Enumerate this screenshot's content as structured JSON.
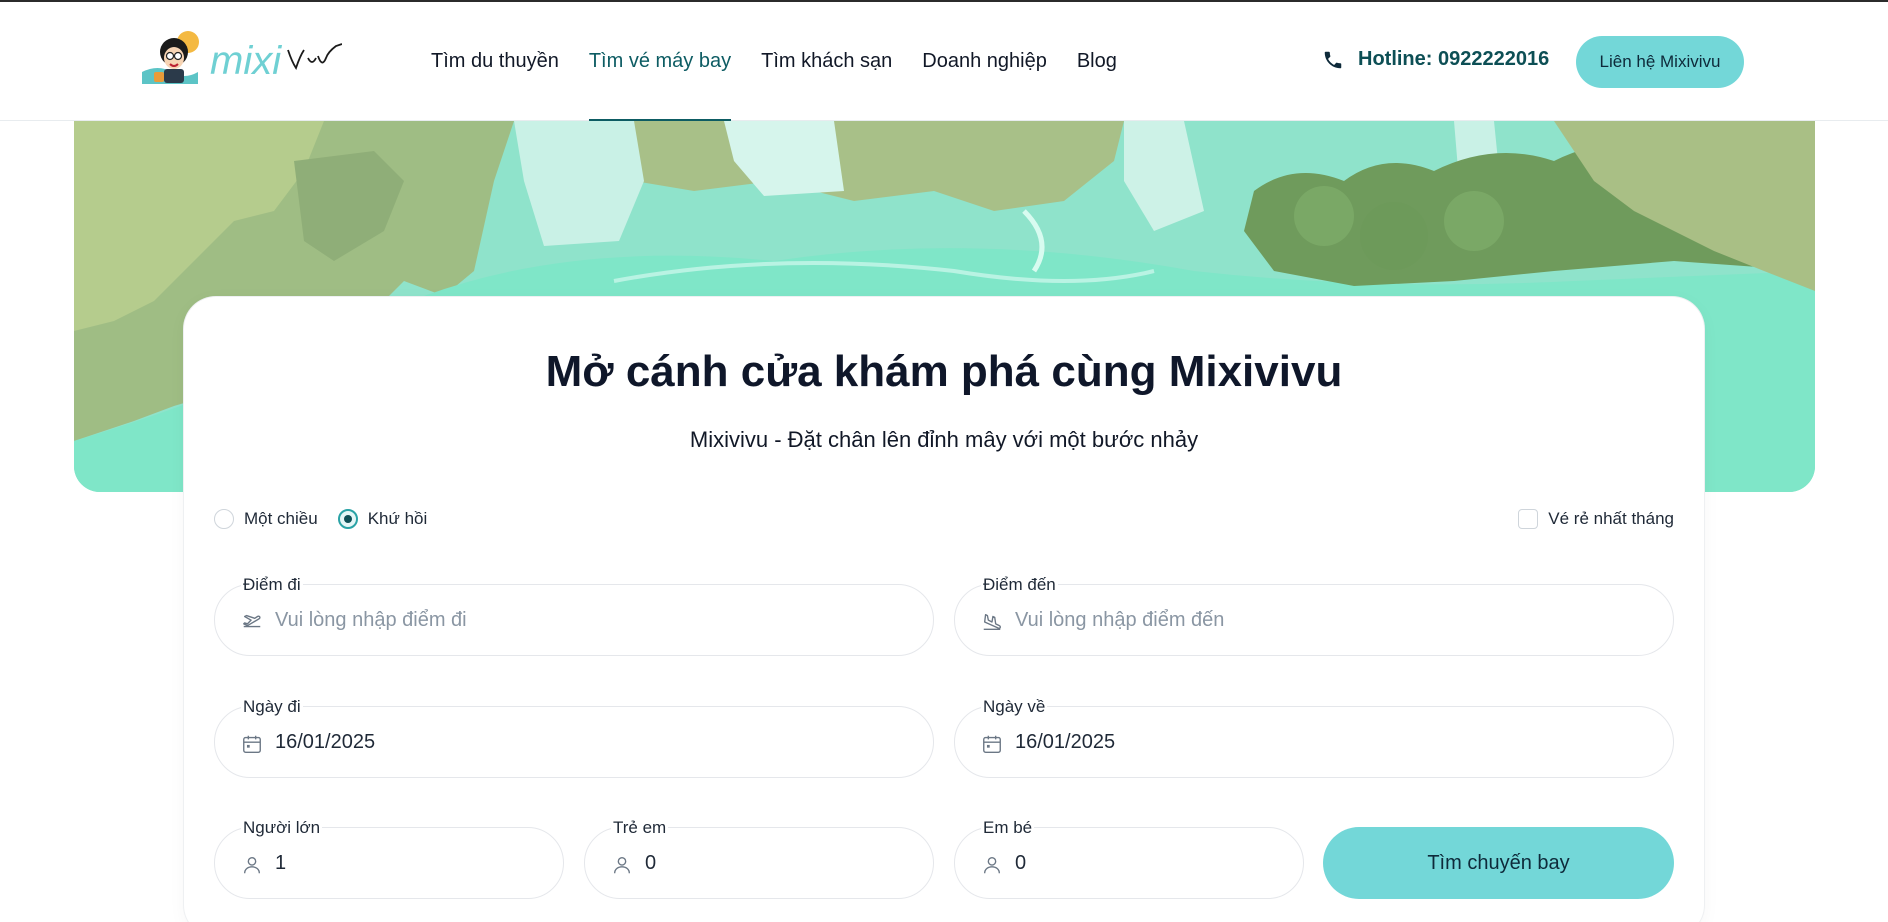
{
  "header": {
    "logo_text": "mixi Vivu",
    "nav": [
      {
        "label": "Tìm du thuyền",
        "active": false
      },
      {
        "label": "Tìm vé máy bay",
        "active": true
      },
      {
        "label": "Tìm khách sạn",
        "active": false
      },
      {
        "label": "Doanh nghiệp",
        "active": false
      },
      {
        "label": "Blog",
        "active": false
      }
    ],
    "hotline": "Hotline: 0922222016",
    "contact_button": "Liên hệ Mixivivu"
  },
  "search": {
    "title": "Mở cánh cửa khám phá cùng Mixivivu",
    "subtitle": "Mixivivu - Đặt chân lên đỉnh mây với một bước nhảy",
    "trip_types": [
      {
        "label": "Một chiều",
        "checked": false
      },
      {
        "label": "Khứ hồi",
        "checked": true
      }
    ],
    "cheapest_label": "Vé rẻ nhất tháng",
    "from": {
      "label": "Điểm đi",
      "placeholder": "Vui lòng nhập điểm đi",
      "icon": "plane-takeoff-icon"
    },
    "to": {
      "label": "Điểm đến",
      "placeholder": "Vui lòng nhập điểm đến",
      "icon": "plane-landing-icon"
    },
    "depart": {
      "label": "Ngày đi",
      "value": "16/01/2025",
      "icon": "calendar-icon"
    },
    "return": {
      "label": "Ngày về",
      "value": "16/01/2025",
      "icon": "calendar-icon"
    },
    "adults": {
      "label": "Người lớn",
      "value": "1",
      "icon": "user-icon"
    },
    "children": {
      "label": "Trẻ em",
      "value": "0",
      "icon": "user-icon"
    },
    "infants": {
      "label": "Em bé",
      "value": "0",
      "icon": "user-icon"
    },
    "submit": "Tìm chuyến bay"
  },
  "colors": {
    "accent": "#73d7d8",
    "brand_dark": "#0d4f55",
    "hero_green": "#8fe3cb"
  }
}
